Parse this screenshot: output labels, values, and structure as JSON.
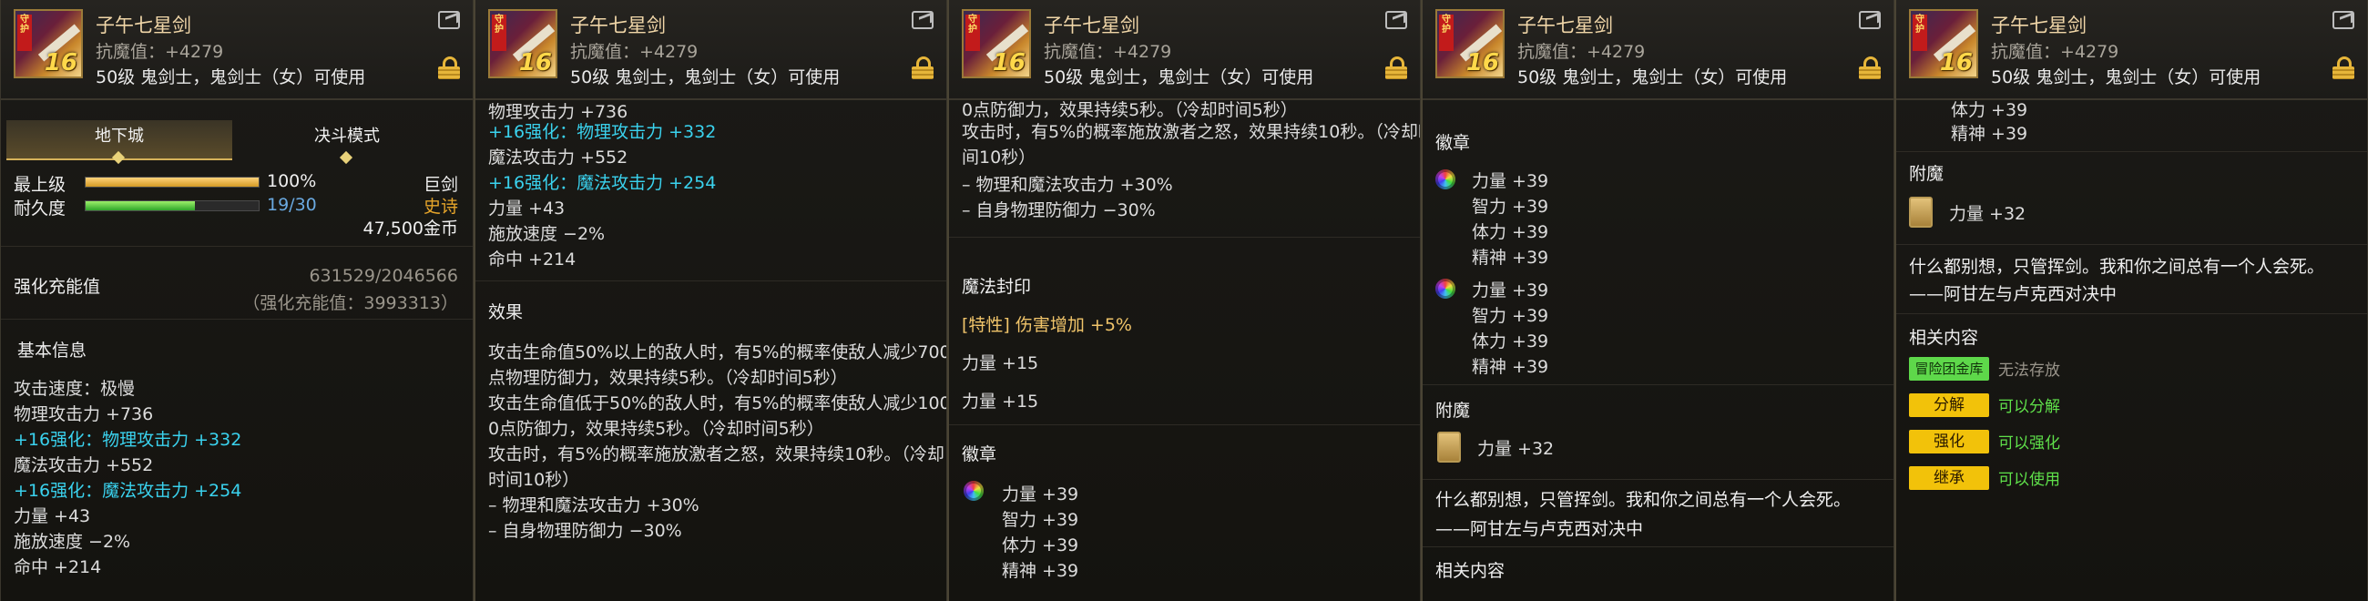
{
  "item": {
    "name": "子午七星剑",
    "magic_res": "抗魔值：+4279",
    "requirement": "50级 鬼剑士，鬼剑士（女）可使用",
    "badge_text": "守护",
    "enhance_level": "16"
  },
  "tabs": [
    "地下城",
    "决斗模式"
  ],
  "status": {
    "max_label": "最上级",
    "max_value": "100%",
    "max_fill": 1.0,
    "dur_label": "耐久度",
    "dur_value": "19/30",
    "dur_fill": 0.633,
    "weapon_type": "巨剑",
    "rarity": "史诗",
    "price": "47,500金币"
  },
  "charge": {
    "label": "强化充能值",
    "value": "631529/2046566",
    "sub": "（强化充能值：3993313）"
  },
  "basic_info": {
    "title": "基本信息",
    "attack_speed": "攻击速度：极慢",
    "phys_atk": "物理攻击力 +736",
    "phys_bonus": "+16强化：物理攻击力 +332",
    "mag_atk": "魔法攻击力 +552",
    "mag_bonus": "+16强化：魔法攻击力 +254",
    "str": "力量 +43",
    "cast_speed": "施放速度 −2%",
    "hit": "命中 +214"
  },
  "effect": {
    "title": "效果",
    "line1a": "攻击生命值50%以上的敌人时，有5%的概率使敌人减少700",
    "line1b": "点物理防御力，效果持续5秒。（冷却时间5秒）",
    "line2a": "攻击生命值低于50%的敌人时，有5%的概率使敌人减少100",
    "line2b": "0点防御力，效果持续5秒。（冷却时间5秒）",
    "line3a": "攻击时，有5%的概率施放激者之怒，效果持续10秒。（冷却",
    "line3b": "时间10秒）",
    "line4": "– 物理和魔法攻击力 +30%",
    "line5": "– 自身物理防御力 −30%",
    "partial1": "物理攻击力 +736",
    "partial2": "0点防御力，效果持续5秒。（冷却时间5秒）",
    "line3b_alt": "间10秒）",
    "line3a_alt": "攻击时，有5%的概率施放激者之怒，效果持续10秒。（冷却时"
  },
  "seal": {
    "title": "魔法封印",
    "special": "[特性] 伤害增加 +5%",
    "stat1": "力量 +15",
    "stat2": "力量 +15"
  },
  "emblem": {
    "title": "徽章",
    "group": [
      "力量 +39",
      "智力 +39",
      "体力 +39",
      "精神 +39"
    ]
  },
  "enchant": {
    "title": "附魔",
    "stat": "力量 +32"
  },
  "flavor": {
    "line1": "什么都别想，只管挥剑。我和你之间总有一个人会死。",
    "line2": "——阿甘左与卢克西对决中"
  },
  "related": {
    "title": "相关内容",
    "items": [
      {
        "badge": "冒险团金库",
        "value": "无法存放"
      },
      {
        "badge": "分解",
        "value": "可以分解"
      },
      {
        "badge": "强化",
        "value": "可以强化"
      },
      {
        "badge": "继承",
        "value": "可以使用"
      }
    ]
  }
}
